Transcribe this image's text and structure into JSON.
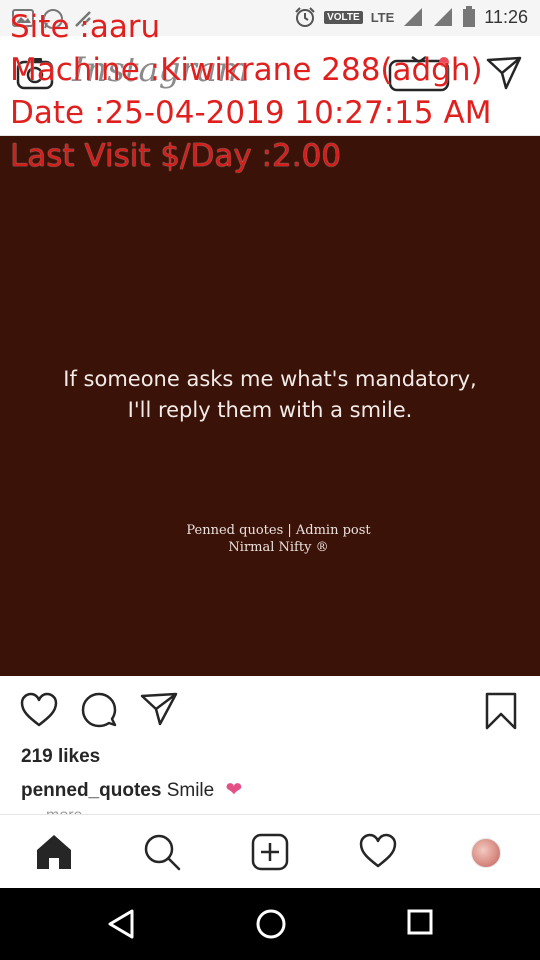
{
  "status_bar": {
    "time": "11:26",
    "volte": "VOLTE",
    "lte": "LTE"
  },
  "app": {
    "logo": "Instagram"
  },
  "overlay": {
    "site": "Site :aaru",
    "machine": "Machine :Kiwikrane 288(adgh)",
    "date": "Date :25-04-2019 10:27:15 AM",
    "last_visit": "Last Visit $/Day :2.00",
    "color": "#e0201e"
  },
  "post": {
    "background": "#3a1208",
    "quote_line1": "If someone asks me what's mandatory,",
    "quote_line2": "I'll reply them with a smile.",
    "credit_line1": "Penned quotes | Admin post",
    "credit_line2": "Nirmal Nifty ®",
    "likes": "219 likes",
    "caption_user": "penned_quotes",
    "caption_text": "Smile",
    "caption_emoji": "❤",
    "more": "more"
  },
  "icons": {
    "actions": [
      "heart-icon",
      "comment-icon",
      "share-icon",
      "bookmark-icon"
    ],
    "bottom_nav": [
      "home-icon",
      "search-icon",
      "add-post-icon",
      "activity-heart-icon",
      "profile-avatar"
    ],
    "android_nav": [
      "back-icon",
      "home-circle-icon",
      "recents-icon"
    ]
  }
}
